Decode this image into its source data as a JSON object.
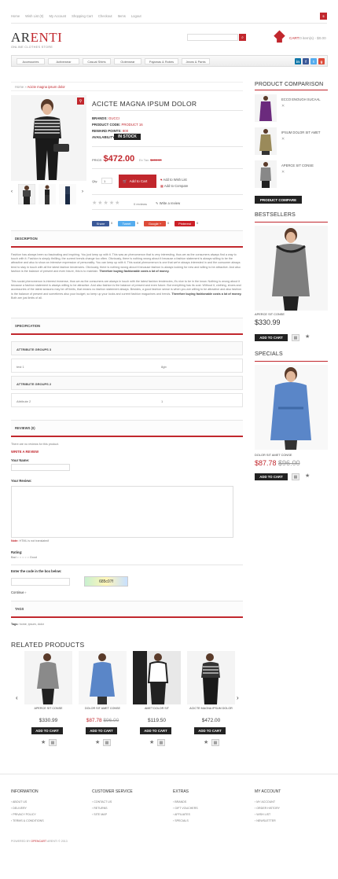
{
  "top_nav": [
    "Home",
    "Wish List (0)",
    "My Account",
    "Shopping Cart",
    "Checkout",
    "Items",
    "Logout"
  ],
  "top_button": "$",
  "logo": {
    "part1": "AR",
    "part2": "ENTI",
    "tagline": "ONLINE CLOTHES STORE"
  },
  "cart": {
    "label": "CART:",
    "value": "0 item(s) - $0.00"
  },
  "menu": [
    "Accessories",
    "Activewear",
    "Casual Shirts",
    "Outerwear",
    "Pajamas & Robes",
    "Jeans & Pants"
  ],
  "breadcrumb": {
    "home": "Home",
    "sep": " » ",
    "current": "Acicte magna ipsum dolor"
  },
  "product": {
    "title": "ACICTE MAGNA IPSUM DOLOR",
    "brand_label": "BRANDS:",
    "brand": "GUCCI",
    "code_label": "PRODUCT CODE:",
    "code": "PRODUCT 16",
    "points_label": "REWARD POINTS:",
    "points": "800",
    "avail_label": "AVAILABILITY:",
    "avail": "IN STOCK",
    "price_label": "PRICE:",
    "price": "$472.00",
    "extax_label": "Ex Tax:",
    "extax": "$400.00",
    "qty_label": "Qty:",
    "qty": "1",
    "add_to_cart": "Add to Cart",
    "wishlist": "Add to Wish List",
    "compare": "Add to Compare",
    "reviews": "0 reviews",
    "write_review": "Write a review"
  },
  "share": [
    {
      "label": "Share",
      "count": "0",
      "color": "#3b5998"
    },
    {
      "label": "Tweet",
      "count": "0",
      "color": "#55acee"
    },
    {
      "label": "Google +",
      "count": "0",
      "color": "#dd4b39"
    },
    {
      "label": "Pinterest",
      "count": "0",
      "color": "#cb2027"
    }
  ],
  "description": {
    "head": "DESCRIPTION",
    "p1": "Fashion has always been so fascinating and inspiring. You just keep up with it. This was an phenomenon that is very interesting, thus we as the consumers always find a way to touch with it. Fashion is simply thrilling, the current trends change too often. Obviously, there is nothing wrong about it because a fashion statement is always willing to be the attractive and also to show an intensive expression of personality. You can keep up with it. This social phenomenon is one that we're always interested in and the consumer always tend to stay in touch with all the latest fashion tendencies. Obviously, there is nothing wrong about it because fashion is always looking for new and willing to be attractive. And also fashion is the balance of present and even future, this is to maintain. ",
    "p1b": "Therefore buying fashionable costs a lot of money.",
    "p2": "This social phenomenon is interest immense, thus we as the consumers are always in touch with the latest fashion tendencies, it's nice to be in the know. Nothing is wrong about it because a fashion statement is always willing to be attractive. And also fashion is the balance of present and even future. But everything has its cost. Without it, clothing, shoes and accessories of the latest seasons may be off limits, that means no fashion statement always. Besides, a good fashion sense is when you are willing to be attractive and also fashion is the balance of present and sometimes also your budget, so keep up your looks and current fashion magazines and trends. ",
    "p2b": "Therefore buying fashionable costs a lot of money.",
    "p2c": " Both are just limits of all."
  },
  "spec": {
    "head": "SPECIFICATION",
    "groups": [
      {
        "name": "ATTRIBUTE GROUPS 3",
        "row": {
          "k": "test 1",
          "v": "8gb"
        }
      },
      {
        "name": "ATTRIBUTE GROUPS 2",
        "row": {
          "k": "Attribute 2",
          "v": "1"
        }
      }
    ]
  },
  "reviews": {
    "head": "REVIEWS (0)",
    "none": "There are no reviews for this product.",
    "write": "WRITE A REVIEW",
    "name_label": "Your Name:",
    "review_label": "Your Review:",
    "note_label": "Note:",
    "note": "HTML is not translated!",
    "rating_label": "Rating:",
    "bad": "Bad",
    "good": "Good",
    "captcha_label": "Enter the code in the box below:",
    "captcha": "685c07f",
    "continue": "Continue"
  },
  "tags": {
    "head": "TAGS",
    "label": "Tags:",
    "value": "home, ipsum, dolor"
  },
  "related": {
    "title": "RELATED PRODUCTS",
    "items": [
      {
        "name": "APERCE SIT CONSE",
        "price": "$330.99",
        "old": "",
        "new": ""
      },
      {
        "name": "DOLOR SIT AMET CONSE",
        "price": "",
        "old": "$96.00",
        "new": "$87.78"
      },
      {
        "name": "AMET DOLOR SIT",
        "price": "$119.50",
        "old": "",
        "new": ""
      },
      {
        "name": "ACICTE MAGNA IPSUM DOLOR",
        "price": "$472.00",
        "old": "",
        "new": ""
      }
    ],
    "add": "ADD TO CART"
  },
  "sidebar": {
    "compare_head": "PRODUCT COMPARISON",
    "compare": [
      "ECCO ENOUGH SUCAAL",
      "IPSUM DOLOR SIT AMET",
      "APERCE SIT CONSE"
    ],
    "compare_btn": "PRODUCT COMPARE",
    "best_head": "BESTSELLERS",
    "best": {
      "name": "APERCE SIT CONSE",
      "price": "$330.99"
    },
    "spec_head": "SPECIALS",
    "special": {
      "name": "DOLOR SIT AMET CONSE",
      "new": "$87.78",
      "old": "$96.00"
    },
    "add": "ADD TO CART"
  },
  "footer": {
    "cols": [
      {
        "title": "INFORMATION",
        "links": [
          "ABOUT US",
          "DELIVERY",
          "PRIVACY POLICY",
          "TERMS & CONDITIONS"
        ]
      },
      {
        "title": "CUSTOMER SERVICE",
        "links": [
          "CONTACT US",
          "RETURNS",
          "SITE MAP"
        ]
      },
      {
        "title": "EXTRAS",
        "links": [
          "BRANDS",
          "GIFT VOUCHERS",
          "AFFILIATES",
          "SPECIALS"
        ]
      },
      {
        "title": "MY ACCOUNT",
        "links": [
          "MY ACCOUNT",
          "ORDER HISTORY",
          "WISH LIST",
          "NEWSLETTER"
        ]
      }
    ],
    "powered": "POWERED BY ",
    "brand": "OPENCART",
    "rest": " ARENTI © 2013"
  }
}
